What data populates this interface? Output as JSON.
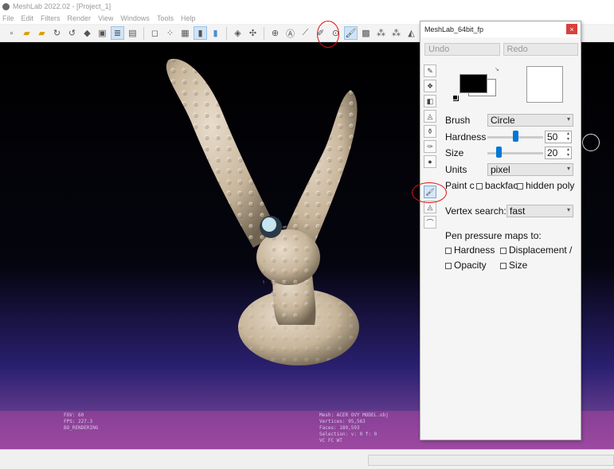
{
  "window_title": "MeshLab 2022.02 - [Project_1]",
  "menu": [
    "File",
    "Edit",
    "Filters",
    "Render",
    "View",
    "Windows",
    "Tools",
    "Help"
  ],
  "viewport_info": {
    "left": [
      "FOV: 60",
      "FPS:   227.3",
      "BO_RENDERING"
    ],
    "right": [
      "Mesh: ACER OVY MODEL.obj",
      "Vertices: 95,563",
      "Faces: 189,593",
      "Selection: v: 0 f: 0",
      "VC FC WT"
    ]
  },
  "panel": {
    "title": "MeshLab_64bit_fp",
    "close": "×",
    "undo": "Undo",
    "redo": "Redo",
    "brush_label": "Brush",
    "brush_value": "Circle",
    "hardness_label": "Hardness",
    "hardness_value": "50",
    "hardness_fraction": 0.5,
    "size_label": "Size",
    "size_value": "20",
    "size_fraction": 0.2,
    "units_label": "Units",
    "units_value": "pixel",
    "paint_label": "Paint c",
    "backface_label": "backfac",
    "hidden_label": "hidden poly",
    "vertex_search_label": "Vertex search:",
    "vertex_search_value": "fast",
    "pressure_title": "Pen pressure maps to:",
    "pressure_hardness": "Hardness",
    "pressure_displacement": "Displacement /",
    "pressure_opacity": "Opacity",
    "pressure_size": "Size"
  },
  "colors": {
    "foreground": "#000000",
    "background": "#ffffff",
    "accent": "#0078d7",
    "annotation": "#e01010"
  }
}
